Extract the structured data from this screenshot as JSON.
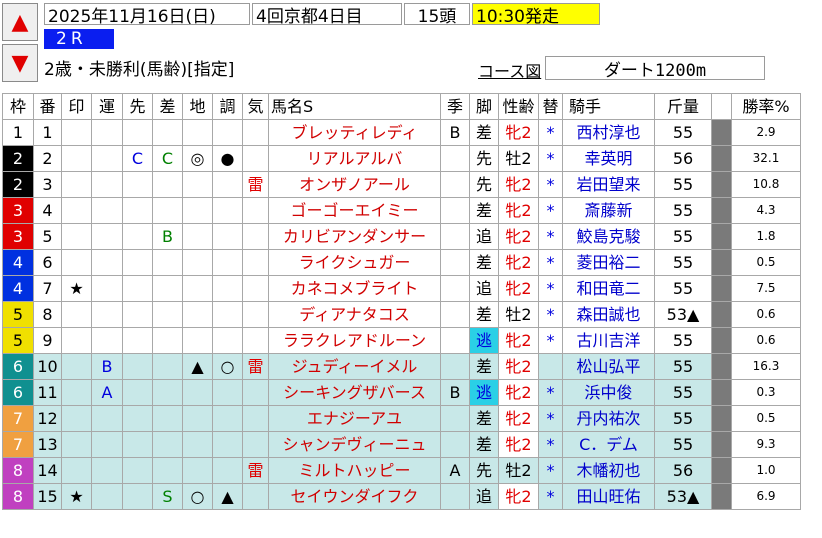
{
  "nav": {
    "up_icon": "▲",
    "down_icon": "▼"
  },
  "header": {
    "date": "2025年11月16日(日)",
    "meeting": "4回京都4日目",
    "runners": "15頭",
    "post_time": "10:30発走",
    "post_time_bg": "#ffff00",
    "race_no": "2R",
    "race_no_bg": "#0a1ef0",
    "condition": "2歳・未勝利(馬齢)[指定]",
    "course_link": "コース図",
    "course": "ダート1200m"
  },
  "columns": [
    "枠",
    "番",
    "印",
    "運",
    "先",
    "差",
    "地",
    "調",
    "気",
    "馬名S",
    "季",
    "脚",
    "性齢",
    "替",
    "騎手",
    "斤量",
    "",
    "勝率%"
  ],
  "waku_colors": {
    "1": "#ffffff",
    "2": "#000000",
    "3": "#e00000",
    "4": "#0030e0",
    "5": "#f0e000",
    "6": "#109090",
    "7": "#f0a040",
    "8": "#c040c0"
  },
  "rows": [
    {
      "waku": "1",
      "umaban": "1",
      "in": "",
      "un": "",
      "saki": "",
      "sa": "",
      "chi": "",
      "cho": "",
      "ki": "",
      "name": "ブレッティレディ",
      "kisetsu": "B",
      "kyaku": "差",
      "sex": "牝2",
      "kawari": "*",
      "jockey": "西村淳也",
      "kinryo": "55",
      "rate": "2.9",
      "rowbg": "#ffffff"
    },
    {
      "waku": "2",
      "umaban": "2",
      "in": "",
      "un": "",
      "saki": "C",
      "sa": "C",
      "chi": "◎",
      "cho": "●",
      "ki": "",
      "name": "リアルアルバ",
      "kisetsu": "",
      "kyaku": "先",
      "sex": "牡2",
      "kawari": "*",
      "jockey": "幸英明",
      "kinryo": "56",
      "rate": "32.1",
      "rowbg": "#ffffff"
    },
    {
      "waku": "2",
      "umaban": "3",
      "in": "",
      "un": "",
      "saki": "",
      "sa": "",
      "chi": "",
      "cho": "",
      "ki": "雷",
      "name": "オンザノアール",
      "kisetsu": "",
      "kyaku": "先",
      "sex": "牝2",
      "kawari": "*",
      "jockey": "岩田望来",
      "kinryo": "55",
      "rate": "10.8",
      "rowbg": "#ffffff"
    },
    {
      "waku": "3",
      "umaban": "4",
      "in": "",
      "un": "",
      "saki": "",
      "sa": "",
      "chi": "",
      "cho": "",
      "ki": "",
      "name": "ゴーゴーエイミー",
      "kisetsu": "",
      "kyaku": "差",
      "sex": "牝2",
      "kawari": "*",
      "jockey": "斎藤新",
      "kinryo": "55",
      "rate": "4.3",
      "rowbg": "#ffffff"
    },
    {
      "waku": "3",
      "umaban": "5",
      "in": "",
      "un": "",
      "saki": "",
      "sa": "B",
      "chi": "",
      "cho": "",
      "ki": "",
      "name": "カリビアンダンサー",
      "kisetsu": "",
      "kyaku": "追",
      "sex": "牝2",
      "kawari": "*",
      "jockey": "鮫島克駿",
      "kinryo": "55",
      "rate": "1.8",
      "rowbg": "#ffffff"
    },
    {
      "waku": "4",
      "umaban": "6",
      "in": "",
      "un": "",
      "saki": "",
      "sa": "",
      "chi": "",
      "cho": "",
      "ki": "",
      "name": "ライクシュガー",
      "kisetsu": "",
      "kyaku": "差",
      "sex": "牝2",
      "kawari": "*",
      "jockey": "菱田裕二",
      "kinryo": "55",
      "rate": "0.5",
      "rowbg": "#ffffff"
    },
    {
      "waku": "4",
      "umaban": "7",
      "in": "★",
      "un": "",
      "saki": "",
      "sa": "",
      "chi": "",
      "cho": "",
      "ki": "",
      "name": "カネコメブライト",
      "kisetsu": "",
      "kyaku": "追",
      "sex": "牝2",
      "kawari": "*",
      "jockey": "和田竜二",
      "kinryo": "55",
      "rate": "7.5",
      "rowbg": "#ffffff"
    },
    {
      "waku": "5",
      "umaban": "8",
      "in": "",
      "un": "",
      "saki": "",
      "sa": "",
      "chi": "",
      "cho": "",
      "ki": "",
      "name": "ディアナタコス",
      "kisetsu": "",
      "kyaku": "差",
      "sex": "牡2",
      "kawari": "*",
      "jockey": "森田誠也",
      "kinryo": "53▲",
      "rate": "0.6",
      "rowbg": "#ffffff"
    },
    {
      "waku": "5",
      "umaban": "9",
      "in": "",
      "un": "",
      "saki": "",
      "sa": "",
      "chi": "",
      "cho": "",
      "ki": "",
      "name": "ララクレアドルーン",
      "kisetsu": "",
      "kyaku": "逃",
      "sex": "牝2",
      "kawari": "*",
      "jockey": "古川吉洋",
      "kinryo": "55",
      "rate": "0.6",
      "rowbg": "#ffffff"
    },
    {
      "waku": "6",
      "umaban": "10",
      "in": "",
      "un": "B",
      "saki": "",
      "sa": "",
      "chi": "▲",
      "cho": "○",
      "ki": "雷",
      "name": "ジュディーイメル",
      "kisetsu": "",
      "kyaku": "差",
      "sex": "牝2",
      "kawari": "",
      "jockey": "松山弘平",
      "kinryo": "55",
      "rate": "16.3",
      "rowbg": "#c8e8e8"
    },
    {
      "waku": "6",
      "umaban": "11",
      "in": "",
      "un": "A",
      "saki": "",
      "sa": "",
      "chi": "",
      "cho": "",
      "ki": "",
      "name": "シーキングザバース",
      "kisetsu": "B",
      "kyaku": "逃",
      "sex": "牝2",
      "kawari": "*",
      "jockey": "浜中俊",
      "kinryo": "55",
      "rate": "0.3",
      "rowbg": "#c8e8e8"
    },
    {
      "waku": "7",
      "umaban": "12",
      "in": "",
      "un": "",
      "saki": "",
      "sa": "",
      "chi": "",
      "cho": "",
      "ki": "",
      "name": "エナジーアユ",
      "kisetsu": "",
      "kyaku": "差",
      "sex": "牝2",
      "kawari": "*",
      "jockey": "丹内祐次",
      "kinryo": "55",
      "rate": "0.5",
      "rowbg": "#c8e8e8"
    },
    {
      "waku": "7",
      "umaban": "13",
      "in": "",
      "un": "",
      "saki": "",
      "sa": "",
      "chi": "",
      "cho": "",
      "ki": "",
      "name": "シャンデヴィーニュ",
      "kisetsu": "",
      "kyaku": "差",
      "sex": "牝2",
      "kawari": "*",
      "jockey": "C．デム",
      "kinryo": "55",
      "rate": "9.3",
      "rowbg": "#c8e8e8"
    },
    {
      "waku": "8",
      "umaban": "14",
      "in": "",
      "un": "",
      "saki": "",
      "sa": "",
      "chi": "",
      "cho": "",
      "ki": "雷",
      "name": "ミルトハッピー",
      "kisetsu": "A",
      "kyaku": "先",
      "sex": "牡2",
      "kawari": "*",
      "jockey": "木幡初也",
      "kinryo": "56",
      "rate": "1.0",
      "rowbg": "#c8e8e8"
    },
    {
      "waku": "8",
      "umaban": "15",
      "in": "★",
      "un": "",
      "saki": "",
      "sa": "S",
      "chi": "○",
      "cho": "▲",
      "ki": "",
      "name": "セイウンダイフク",
      "kisetsu": "",
      "kyaku": "追",
      "sex": "牝2",
      "kawari": "*",
      "jockey": "田山旺佑",
      "kinryo": "53▲",
      "rate": "6.9",
      "rowbg": "#c8e8e8"
    }
  ]
}
